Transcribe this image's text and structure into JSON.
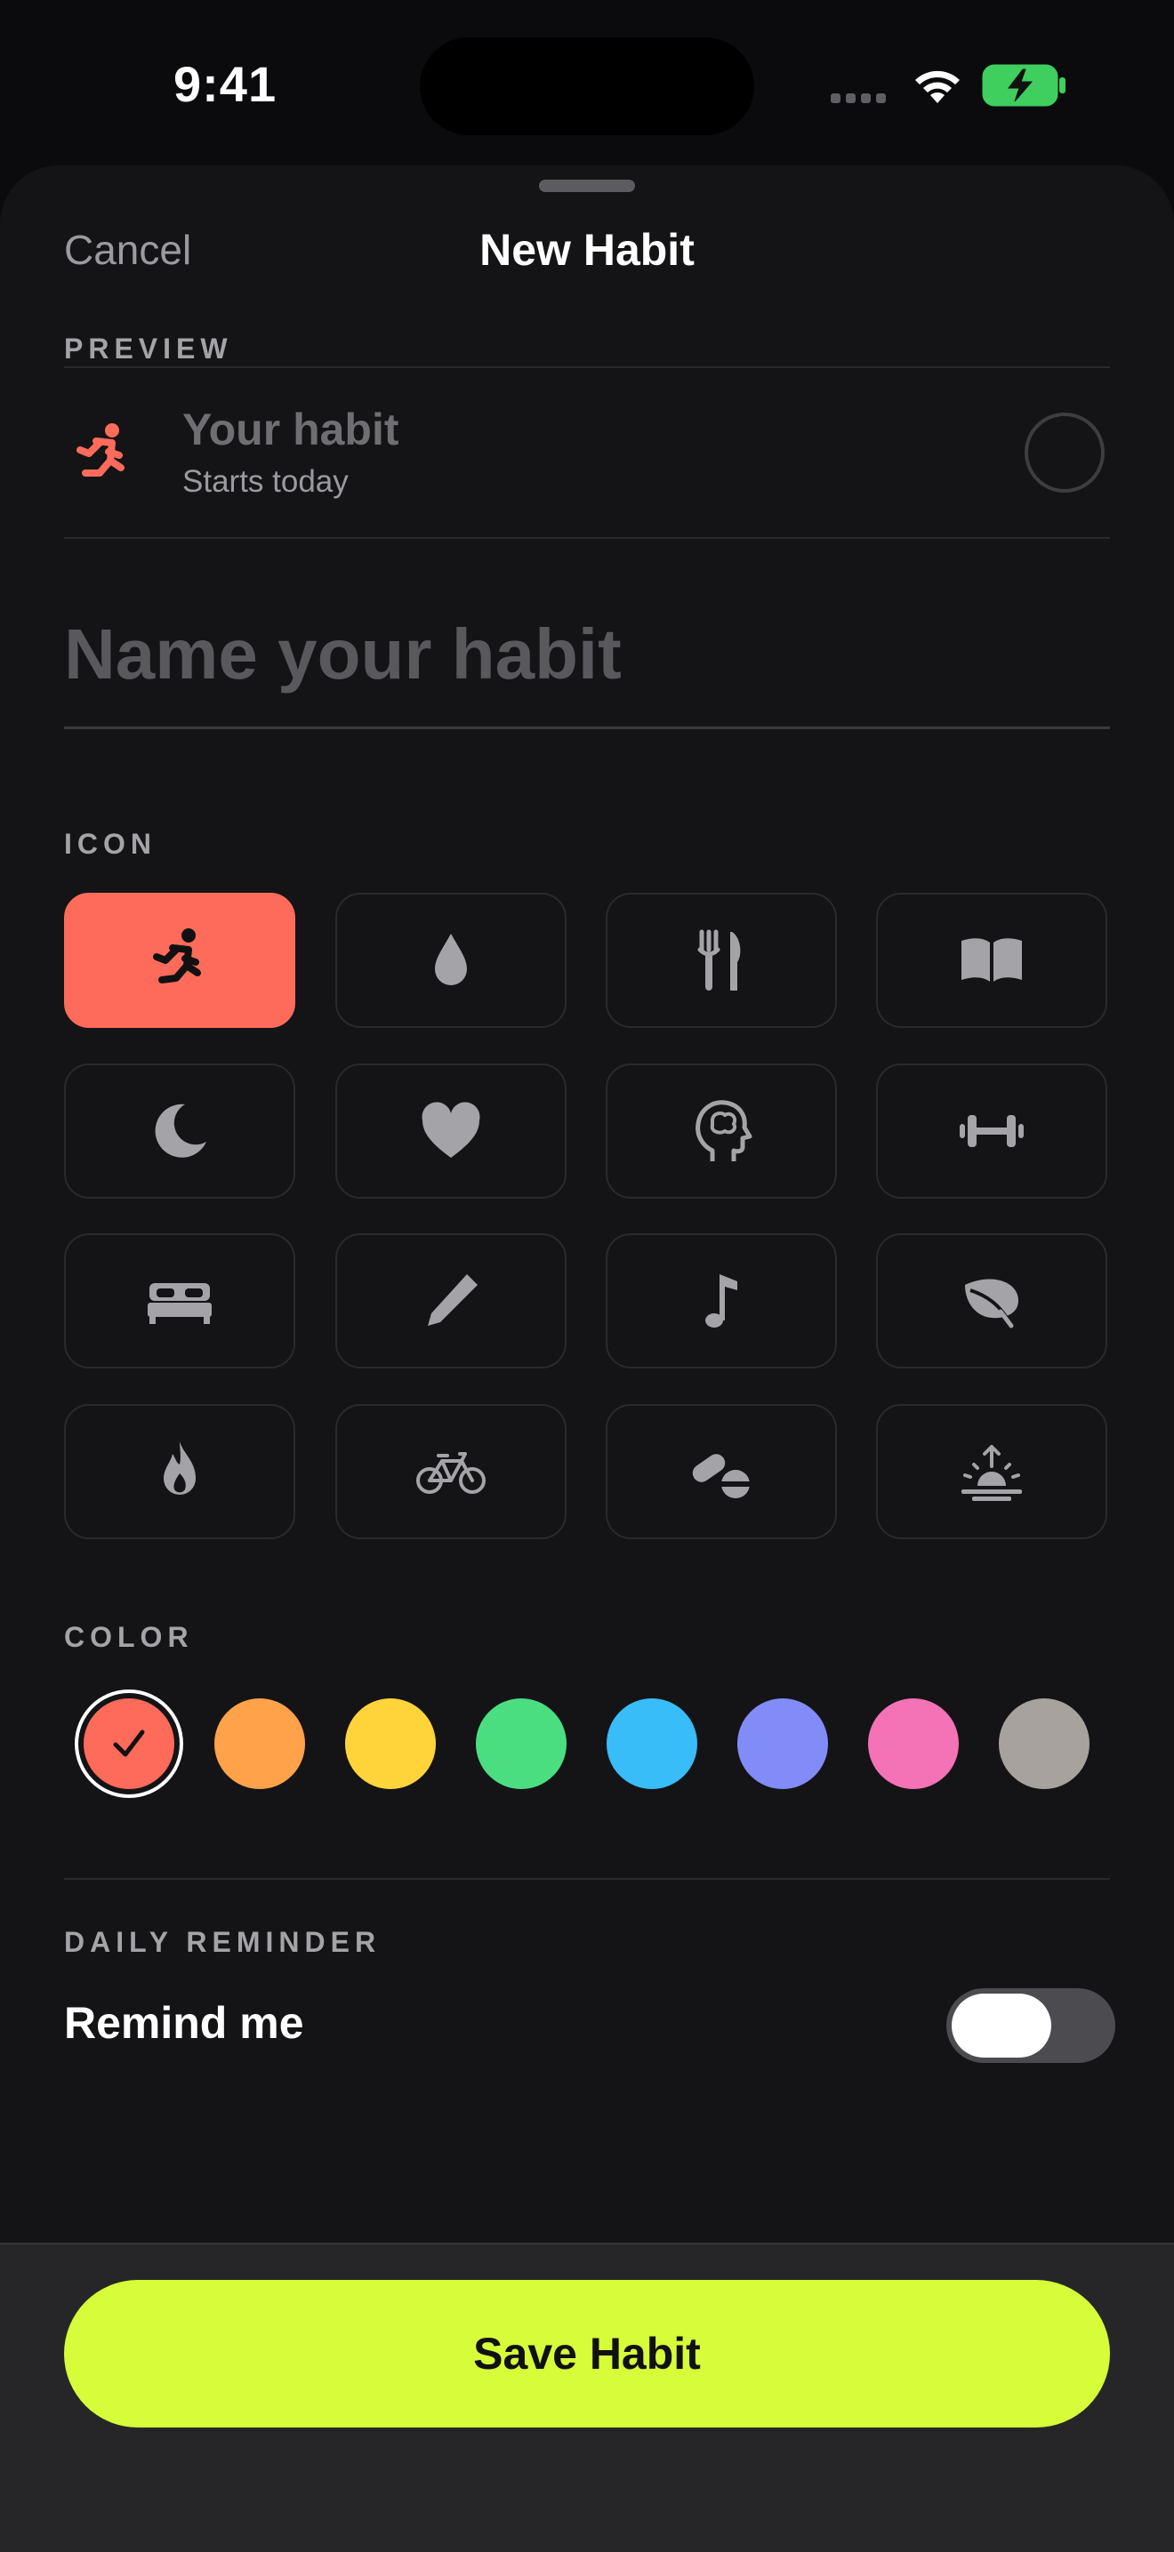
{
  "status_bar": {
    "time": "9:41"
  },
  "sheet": {
    "cancel_label": "Cancel",
    "title": "New Habit"
  },
  "preview": {
    "section_label": "PREVIEW",
    "habit_name": "Your habit",
    "subtitle": "Starts today",
    "icon": "runner-icon"
  },
  "name_field": {
    "value": "",
    "placeholder": "Name your habit"
  },
  "icon_section": {
    "label": "ICON",
    "selected": "runner-icon",
    "icons": [
      "runner-icon",
      "drop-icon",
      "fork-knife-icon",
      "book-icon",
      "moon-icon",
      "heart-icon",
      "brain-head-icon",
      "dumbbell-icon",
      "bed-icon",
      "pencil-icon",
      "music-note-icon",
      "leaf-icon",
      "flame-icon",
      "bicycle-icon",
      "pills-icon",
      "sunrise-icon"
    ]
  },
  "color_section": {
    "label": "COLOR",
    "selected_index": 0,
    "colors": [
      "#ff6b5b",
      "#ffa24a",
      "#ffd43b",
      "#4ade80",
      "#38bdf8",
      "#818cf8",
      "#f472b6",
      "#a8a29e"
    ]
  },
  "reminder": {
    "section_label": "DAILY REMINDER",
    "label": "Remind me",
    "enabled": false
  },
  "save_button": {
    "label": "Save Habit"
  },
  "theme": {
    "accent": "#ff6b5b",
    "primary_button": "#d6fc3a"
  }
}
